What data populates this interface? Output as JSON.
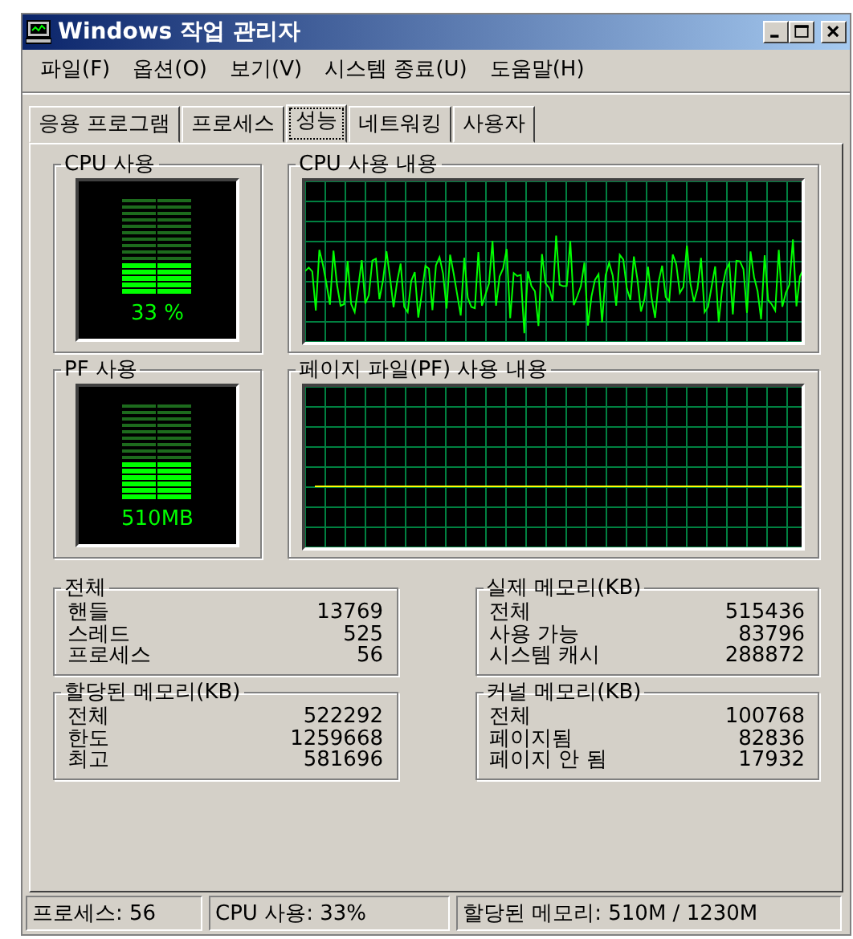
{
  "window": {
    "title": "Windows 작업 관리자"
  },
  "menu": [
    "파일(F)",
    "옵션(O)",
    "보기(V)",
    "시스템 종료(U)",
    "도움말(H)"
  ],
  "tabs": [
    {
      "label": "응용 프로그램",
      "selected": false
    },
    {
      "label": "프로세스",
      "selected": false
    },
    {
      "label": "성능",
      "selected": true
    },
    {
      "label": "네트워킹",
      "selected": false
    },
    {
      "label": "사용자",
      "selected": false
    }
  ],
  "cpu_usage": {
    "title": "CPU 사용",
    "level": 0.33,
    "reading": "33 %"
  },
  "cpu_history": {
    "title": "CPU 사용 내용"
  },
  "pf_usage": {
    "title": "PF 사용",
    "level": 0.4,
    "reading": "510MB"
  },
  "pf_history": {
    "title": "페이지 파일(PF) 사용 내용"
  },
  "groups": [
    {
      "title": "전체",
      "rows": [
        {
          "label": "핸들",
          "value": "13769"
        },
        {
          "label": "스레드",
          "value": "525"
        },
        {
          "label": "프로세스",
          "value": "56"
        }
      ]
    },
    {
      "title": "실제 메모리(KB)",
      "rows": [
        {
          "label": "전체",
          "value": "515436"
        },
        {
          "label": "사용 가능",
          "value": "83796"
        },
        {
          "label": "시스템 캐시",
          "value": "288872"
        }
      ]
    },
    {
      "title": "할당된 메모리(KB)",
      "rows": [
        {
          "label": "전체",
          "value": "522292"
        },
        {
          "label": "한도",
          "value": "1259668"
        },
        {
          "label": "최고",
          "value": "581696"
        }
      ]
    },
    {
      "title": "커널 메모리(KB)",
      "rows": [
        {
          "label": "전체",
          "value": "100768"
        },
        {
          "label": "페이지됨",
          "value": "82836"
        },
        {
          "label": "페이지 안 됨",
          "value": "17932"
        }
      ]
    }
  ],
  "status_bar": [
    "프로세스: 56",
    "CPU 사용: 33%",
    "할당된 메모리: 510M / 1230M"
  ]
}
